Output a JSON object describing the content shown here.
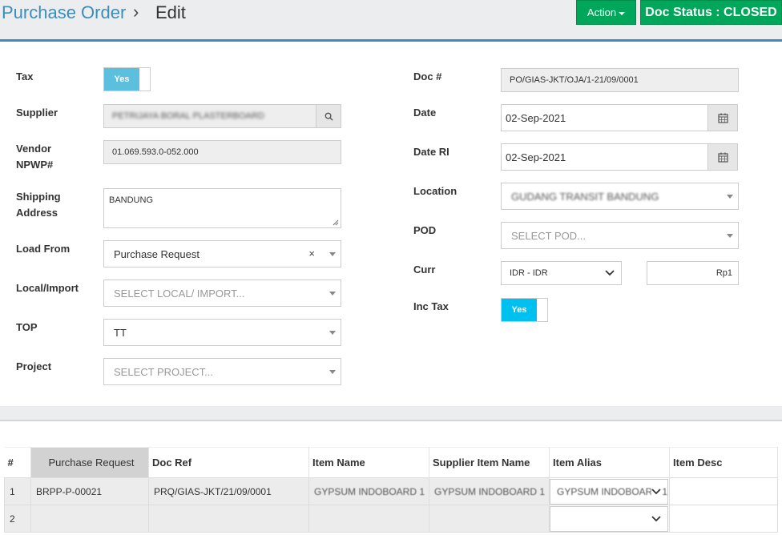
{
  "header": {
    "breadcrumb_parent": "Purchase Order",
    "breadcrumb_sep": "›",
    "breadcrumb_current": "Edit",
    "action_label": "Action",
    "doc_status": "Doc Status : CLOSED"
  },
  "form": {
    "tax": {
      "label": "Tax",
      "toggle": "Yes"
    },
    "supplier": {
      "label": "Supplier",
      "value": "PETRIJAYA BORAL PLASTERBOARD"
    },
    "vendor_npwp": {
      "label_line1": "Vendor",
      "label_line2": "NPWP#",
      "value": "01.069.593.0-052.000"
    },
    "shipping_address": {
      "label_line1": "Shipping",
      "label_line2": "Address",
      "value": "BANDUNG"
    },
    "load_from": {
      "label": "Load From",
      "value": "Purchase Request",
      "clear": "×"
    },
    "local_import": {
      "label": "Local/Import",
      "placeholder": "SELECT LOCAL/ IMPORT..."
    },
    "top": {
      "label": "TOP",
      "value": "TT"
    },
    "project": {
      "label": "Project",
      "placeholder": "SELECT PROJECT..."
    },
    "doc_no": {
      "label": "Doc #",
      "value": "PO/GIAS-JKT/OJA/1-21/09/0001"
    },
    "date": {
      "label": "Date",
      "value": "02-Sep-2021"
    },
    "date_ri": {
      "label": "Date RI",
      "value": "02-Sep-2021"
    },
    "location": {
      "label": "Location",
      "value": "GUDANG TRANSIT BANDUNG"
    },
    "pod": {
      "label": "POD",
      "placeholder": "SELECT POD..."
    },
    "curr": {
      "label": "Curr",
      "value": "IDR - IDR",
      "symbol": "Rp1"
    },
    "inc_tax": {
      "label": "Inc Tax",
      "toggle": "Yes"
    }
  },
  "table": {
    "headers": [
      "#",
      "Purchase Request",
      "Doc Ref",
      "Item Name",
      "Supplier Item Name",
      "Item Alias",
      "Item Desc"
    ],
    "rows": [
      {
        "no": "1",
        "pr": "BRPP-P-00021",
        "doc_ref": "PRQ/GIAS-JKT/21/09/0001",
        "item_name": "GYPSUM INDOBOARD 1",
        "supplier_item": "GYPSUM INDOBOARD 1",
        "alias": "GYPSUM INDOBOARD 1",
        "desc": ""
      },
      {
        "no": "2",
        "pr": "",
        "doc_ref": "",
        "item_name": "",
        "supplier_item": "",
        "alias": "",
        "desc": ""
      }
    ]
  },
  "colors": {
    "accent": "#3c8dbc",
    "success": "#00a65a",
    "toggle": "#5bc0de"
  }
}
